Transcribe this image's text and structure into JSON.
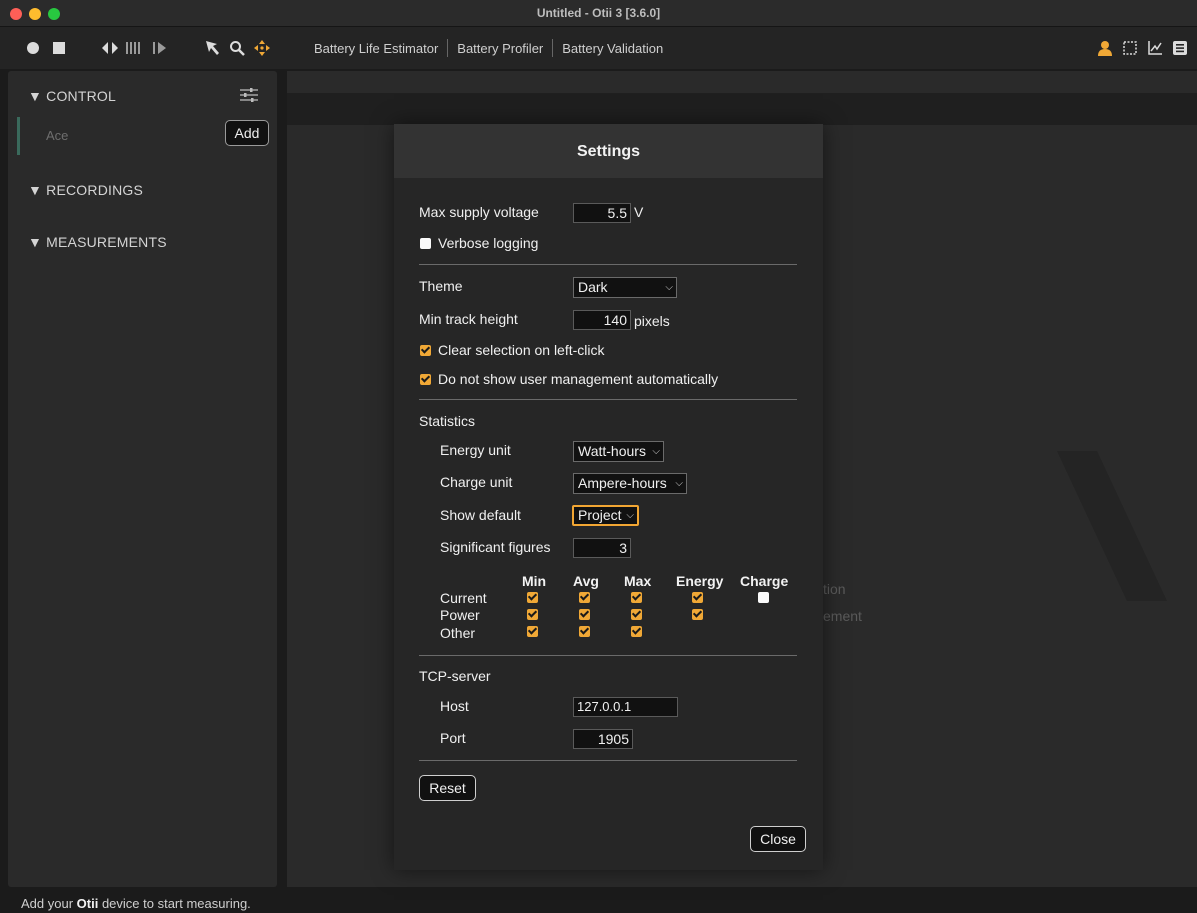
{
  "window": {
    "title": "Untitled - Otii 3 [3.6.0]"
  },
  "toolbar": {
    "tabs": [
      "Battery Life Estimator",
      "Battery Profiler",
      "Battery Validation"
    ]
  },
  "sidebar": {
    "control": {
      "title": "▼ CONTROL",
      "device_label": "Ace",
      "add_label": "Add"
    },
    "recordings": {
      "title": "▼ RECORDINGS"
    },
    "measurements": {
      "title": "▼ MEASUREMENTS"
    }
  },
  "background": {
    "text1": "tion",
    "text2": "ement"
  },
  "statusbar": {
    "prefix": "Add your ",
    "bold": "Otii",
    "suffix": " device to start measuring."
  },
  "settings": {
    "title": "Settings",
    "max_supply_voltage": {
      "label": "Max supply voltage",
      "value": "5.5",
      "unit": "V"
    },
    "verbose_logging": {
      "label": "Verbose logging",
      "checked": false
    },
    "theme": {
      "label": "Theme",
      "value": "Dark"
    },
    "min_track_height": {
      "label": "Min track height",
      "value": "140",
      "unit": "pixels"
    },
    "clear_selection": {
      "label": "Clear selection on left-click",
      "checked": true
    },
    "no_user_mgmt": {
      "label": "Do not show user management automatically",
      "checked": true
    },
    "statistics": {
      "label": "Statistics",
      "energy_unit": {
        "label": "Energy unit",
        "value": "Watt-hours"
      },
      "charge_unit": {
        "label": "Charge unit",
        "value": "Ampere-hours"
      },
      "show_default": {
        "label": "Show default",
        "value": "Project"
      },
      "sig_figures": {
        "label": "Significant figures",
        "value": "3"
      },
      "columns": [
        "Min",
        "Avg",
        "Max",
        "Energy",
        "Charge"
      ],
      "rows": [
        {
          "label": "Current",
          "checks": [
            true,
            true,
            true,
            true,
            false
          ]
        },
        {
          "label": "Power",
          "checks": [
            true,
            true,
            true,
            true,
            null
          ]
        },
        {
          "label": "Other",
          "checks": [
            true,
            true,
            true,
            null,
            null
          ]
        }
      ]
    },
    "tcp": {
      "label": "TCP-server",
      "host": {
        "label": "Host",
        "value": "127.0.0.1"
      },
      "port": {
        "label": "Port",
        "value": "1905"
      }
    },
    "reset_label": "Reset",
    "close_label": "Close"
  },
  "colors": {
    "accent": "#f0a836",
    "dialog_bg": "#262626",
    "sidebar_bg": "#2a2a2a"
  }
}
